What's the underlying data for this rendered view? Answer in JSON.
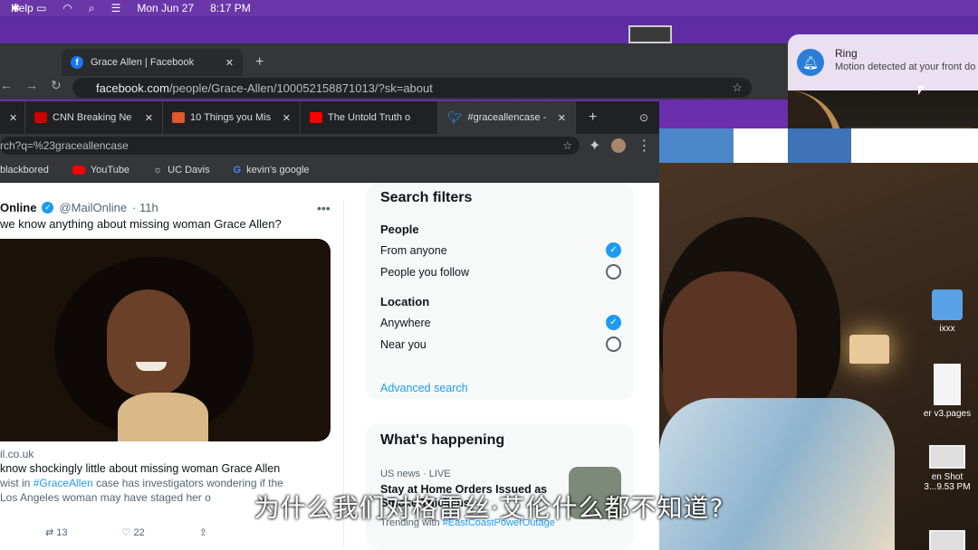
{
  "menubar": {
    "help": "Help",
    "date": "Mon Jun 27",
    "time": "8:17 PM"
  },
  "fb_window": {
    "tab_title": "Grace Allen | Facebook",
    "url_host": "facebook.com",
    "url_path": "/people/Grace-Allen/100052158871013/?sk=about"
  },
  "twitter_window": {
    "tabs": [
      {
        "label": "CNN Breaking Ne",
        "icon": "cnn-icon",
        "color": "#cc0000"
      },
      {
        "label": "10 Things you Mis",
        "icon": "article-icon",
        "color": "#e0582c"
      },
      {
        "label": "The Untold Truth o",
        "icon": "youtube-icon",
        "color": "#ff0000"
      },
      {
        "label": "#graceallencase -",
        "icon": "twitter-icon",
        "color": "#1d9bf0"
      }
    ],
    "url": "rch?q=%23graceallencase",
    "bookmarks": [
      "blackbored",
      "YouTube",
      "UC Davis",
      "kevin's google"
    ]
  },
  "tweet": {
    "name": "Online",
    "handle": "@MailOnline",
    "time": "· 11h",
    "text": "we know anything about missing woman Grace Allen?",
    "card_domain": "il.co.uk",
    "card_title": "know shockingly little about missing woman Grace Allen",
    "card_line1_pre": "wist in ",
    "card_line1_hash": "#GraceAllen",
    "card_line1_post": " case has investigators wondering if the",
    "card_line2": "Los Angeles woman may have staged her o",
    "retweets": "13",
    "likes": "22"
  },
  "filters": {
    "title": "Search filters",
    "people_label": "People",
    "people_opts": [
      "From anyone",
      "People you follow"
    ],
    "location_label": "Location",
    "location_opts": [
      "Anywhere",
      "Near you"
    ],
    "advanced": "Advanced search"
  },
  "happening": {
    "title": "What's happening",
    "meta": "US news · LIVE",
    "headline": "Stay at Home Orders Issued as Smoke Thickens",
    "trending_pre": "Trending with ",
    "trending_tag": "#EastCoastPowerOutage"
  },
  "ring": {
    "title": "Ring",
    "message": "Motion detected at your front do"
  },
  "desktop_icons": [
    "ixxx",
    "er v3.pages",
    "en Shot",
    "3...9.53 PM"
  ],
  "subtitle": "为什么我们对格雷丝·艾伦什么都不知道?"
}
